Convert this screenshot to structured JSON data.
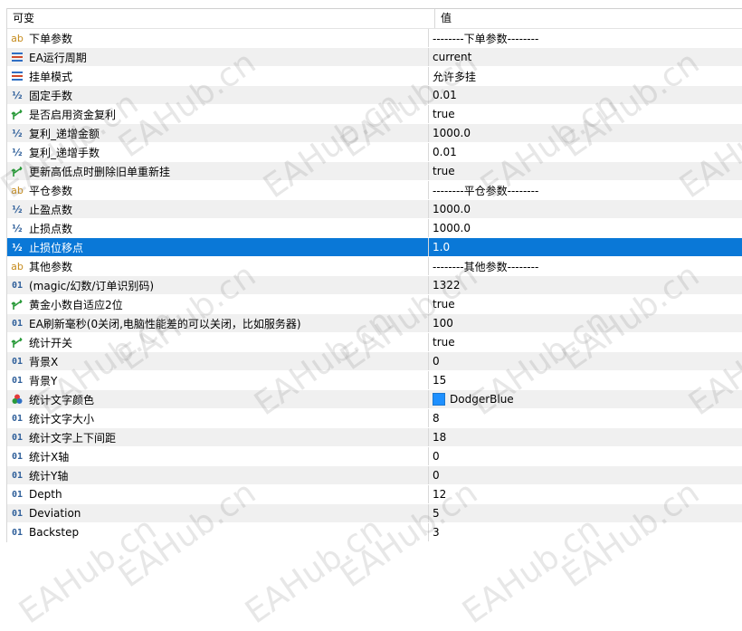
{
  "header": {
    "col_name": "可变",
    "col_value": "值"
  },
  "rows": [
    {
      "icon": "ab",
      "label": "下单参数",
      "value": "--------下单参数--------"
    },
    {
      "icon": "enum",
      "label": "EA运行周期",
      "value": "current"
    },
    {
      "icon": "enum",
      "label": "挂单模式",
      "value": "允许多挂"
    },
    {
      "icon": "half",
      "label": "固定手数",
      "value": "0.01"
    },
    {
      "icon": "bool",
      "label": "是否启用资金复利",
      "value": "true"
    },
    {
      "icon": "half",
      "label": "复利_递增金额",
      "value": "1000.0"
    },
    {
      "icon": "half",
      "label": "复利_递增手数",
      "value": "0.01"
    },
    {
      "icon": "bool",
      "label": "更新高低点时删除旧单重新挂",
      "value": "true"
    },
    {
      "icon": "ab",
      "label": "平仓参数",
      "value": "--------平仓参数--------"
    },
    {
      "icon": "half",
      "label": "止盈点数",
      "value": "1000.0"
    },
    {
      "icon": "half",
      "label": "止损点数",
      "value": "1000.0"
    },
    {
      "icon": "half",
      "label": "止损位移点",
      "value": "1.0",
      "selected": true
    },
    {
      "icon": "ab",
      "label": "其他参数",
      "value": "--------其他参数--------"
    },
    {
      "icon": "01",
      "label": "(magic/幻数/订单识别码)",
      "value": "1322"
    },
    {
      "icon": "bool",
      "label": "黄金小数自适应2位",
      "value": "true"
    },
    {
      "icon": "01",
      "label": "EA刷新毫秒(0关闭,电脑性能差的可以关闭，比如服务器)",
      "value": "100"
    },
    {
      "icon": "bool",
      "label": "统计开关",
      "value": "true"
    },
    {
      "icon": "01",
      "label": "背景X",
      "value": "0"
    },
    {
      "icon": "01",
      "label": "背景Y",
      "value": "15"
    },
    {
      "icon": "color",
      "label": "统计文字颜色",
      "value": "DodgerBlue",
      "swatch": "#1E90FF"
    },
    {
      "icon": "01",
      "label": "统计文字大小",
      "value": "8"
    },
    {
      "icon": "01",
      "label": "统计文字上下间距",
      "value": "18"
    },
    {
      "icon": "01",
      "label": "统计X轴",
      "value": "0"
    },
    {
      "icon": "01",
      "label": "统计Y轴",
      "value": "0"
    },
    {
      "icon": "01",
      "label": "Depth",
      "value": "12"
    },
    {
      "icon": "01",
      "label": "Deviation",
      "value": "5"
    },
    {
      "icon": "01",
      "label": "Backstep",
      "value": "3"
    }
  ],
  "watermark": "EAHub.cn",
  "colors": {
    "selected_row": "#0A78D7",
    "alt_row": "#F0F0F0",
    "swatch": "#1E90FF"
  }
}
